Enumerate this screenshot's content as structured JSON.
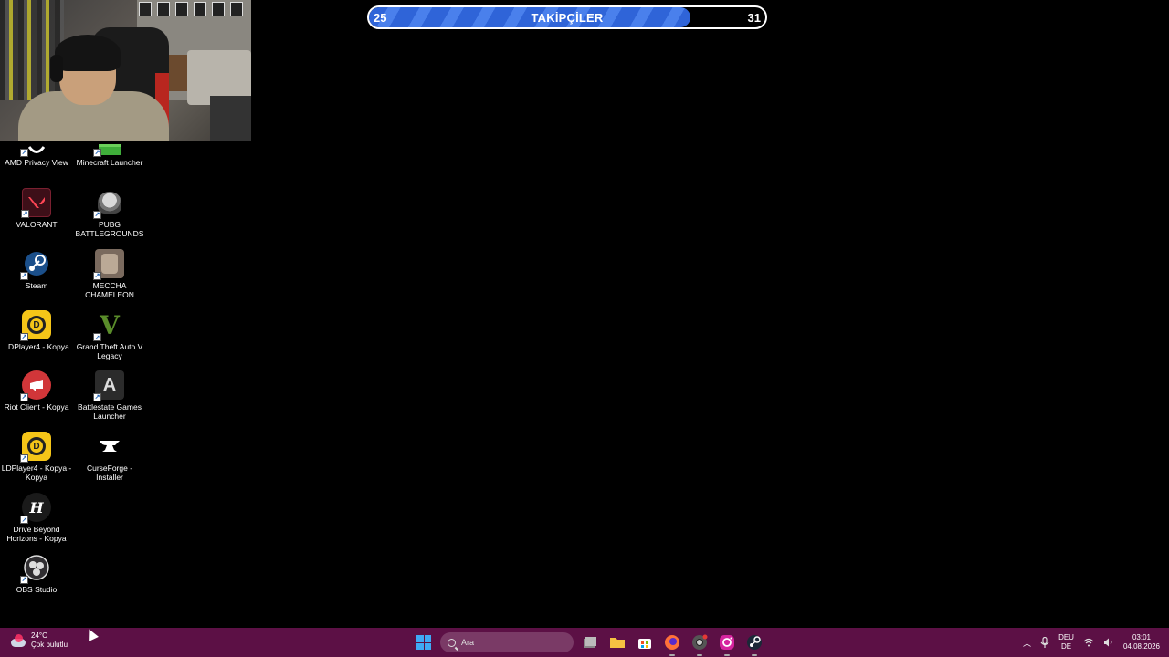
{
  "goal": {
    "start": "25",
    "title": "TAKİPÇİLER",
    "end": "31",
    "progress_fraction": 0.81,
    "fill_color": "#2f64d8"
  },
  "desktop_icons": [
    {
      "label": "AMD Privacy View",
      "icon": "amd-privacy-view-icon"
    },
    {
      "label": "Minecraft Launcher",
      "icon": "minecraft-launcher-icon"
    },
    {
      "label": "VALORANT",
      "icon": "valorant-icon"
    },
    {
      "label": "PUBG BATTLEGROUNDS",
      "icon": "pubg-icon"
    },
    {
      "label": "Steam",
      "icon": "steam-icon"
    },
    {
      "label": "MECCHA CHAMELEON",
      "icon": "meccha-chameleon-icon"
    },
    {
      "label": "LDPlayer4 - Kopya",
      "icon": "ldplayer-icon"
    },
    {
      "label": "Grand Theft Auto V Legacy",
      "icon": "gta-v-icon"
    },
    {
      "label": "Riot Client - Kopya",
      "icon": "riot-client-icon"
    },
    {
      "label": "Battlestate Games Launcher",
      "icon": "battlestate-icon"
    },
    {
      "label": "LDPlayer4 - Kopya - Kopya",
      "icon": "ldplayer-icon"
    },
    {
      "label": "CurseForge - Installer",
      "icon": "curseforge-icon"
    },
    {
      "label": "Drive Beyond Horizons - Kopya",
      "icon": "drive-beyond-horizons-icon"
    },
    {
      "label": "OBS Studio",
      "icon": "obs-studio-icon"
    }
  ],
  "taskbar": {
    "weather_temp": "24°C",
    "weather_desc": "Çok bulutlu",
    "search_placeholder": "Ara",
    "lang_top": "DEU",
    "lang_bottom": "DE",
    "time": "03:01",
    "date": "04.08.2026",
    "pinned": [
      "start-icon",
      "search",
      "task-view-icon",
      "file-explorer-icon",
      "store-icon",
      "firefox-icon",
      "chrome-icon",
      "instagram-icon",
      "steam-icon"
    ]
  }
}
